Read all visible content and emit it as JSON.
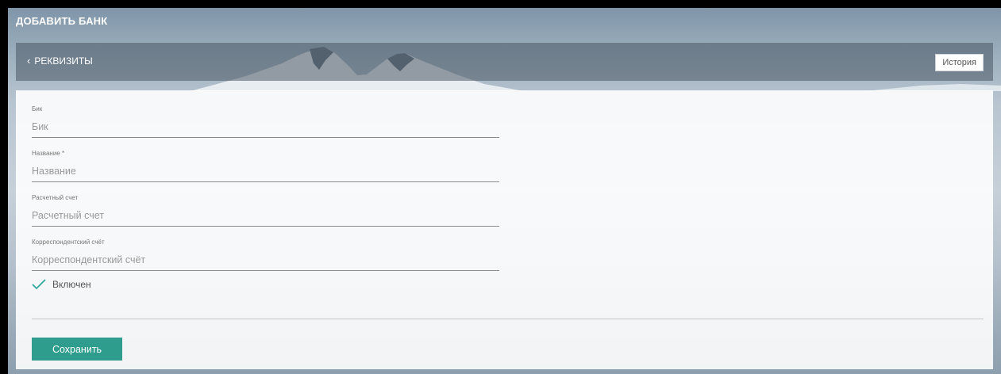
{
  "page": {
    "title": "ДОБАВИТЬ БАНК"
  },
  "header": {
    "back_label": "РЕКВИЗИТЫ",
    "history_label": "История"
  },
  "form": {
    "fields": [
      {
        "label": "Бик",
        "placeholder": "Бик",
        "value": ""
      },
      {
        "label": "Название *",
        "placeholder": "Название",
        "value": ""
      },
      {
        "label": "Расчетный счет",
        "placeholder": "Расчетный счет",
        "value": ""
      },
      {
        "label": "Корреспондентский счёт",
        "placeholder": "Корреспондентский счёт",
        "value": ""
      }
    ],
    "enabled": {
      "label": "Включен",
      "checked": true
    },
    "save_label": "Сохранить"
  },
  "colors": {
    "accent": "#2f9d8e",
    "checkmark": "#26a69a"
  },
  "icons": {
    "back": "chevron-left-icon",
    "checkbox": "checkmark-icon"
  }
}
